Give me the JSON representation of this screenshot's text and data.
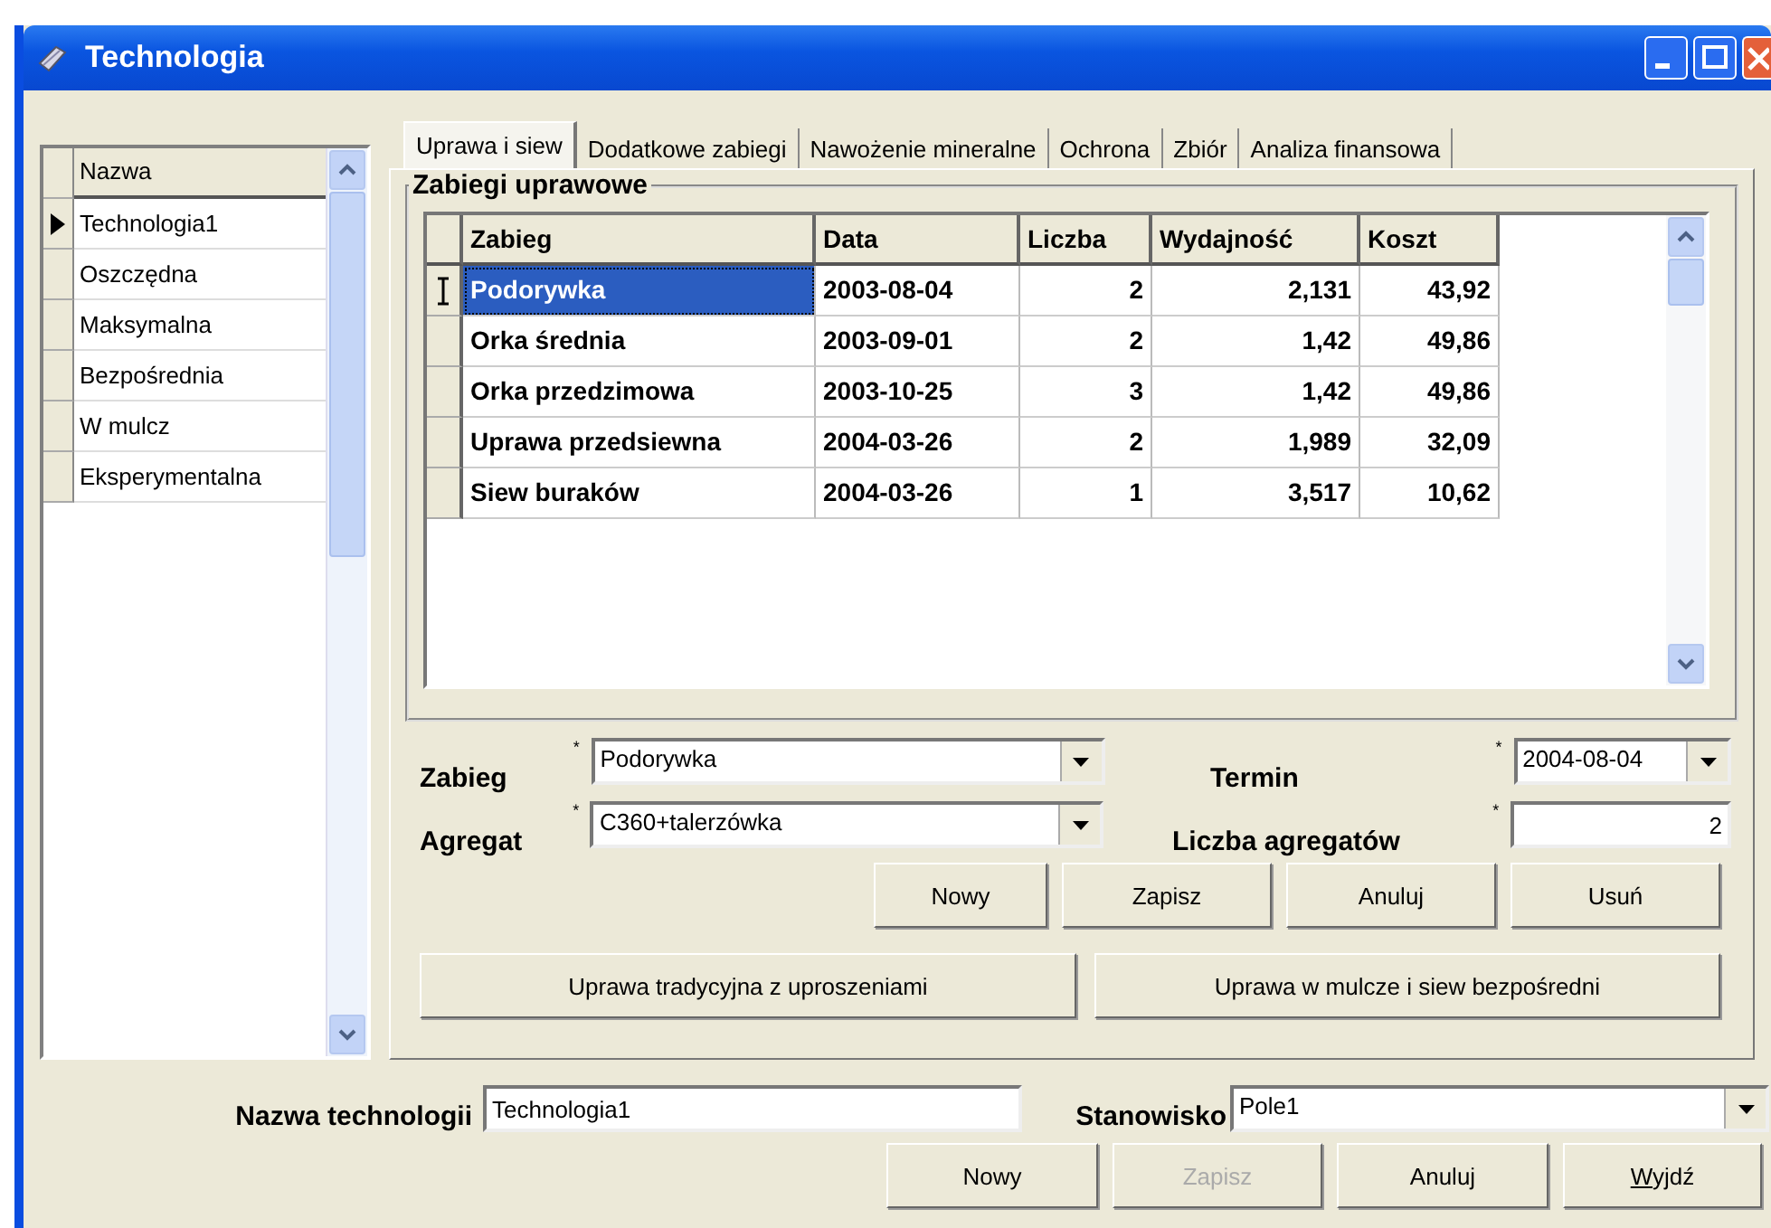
{
  "window": {
    "title": "Technologia"
  },
  "technologies": {
    "column": "Nazwa",
    "rows": [
      {
        "name": "Technologia1",
        "selected": true
      },
      {
        "name": "Oszczędna",
        "selected": false
      },
      {
        "name": "Maksymalna",
        "selected": false
      },
      {
        "name": "Bezpośrednia",
        "selected": false
      },
      {
        "name": "W mulcz",
        "selected": false
      },
      {
        "name": "Eksperymentalna",
        "selected": false
      }
    ]
  },
  "tabs": [
    {
      "label": "Uprawa i siew",
      "selected": true
    },
    {
      "label": "Dodatkowe zabiegi",
      "selected": false
    },
    {
      "label": "Nawożenie mineralne",
      "selected": false
    },
    {
      "label": "Ochrona",
      "selected": false
    },
    {
      "label": "Zbiór",
      "selected": false
    },
    {
      "label": "Analiza finansowa",
      "selected": false
    }
  ],
  "group": {
    "title": "Zabiegi uprawowe",
    "columns": [
      "Zabieg",
      "Data",
      "Liczba",
      "Wydajność",
      "Koszt"
    ],
    "rows": [
      {
        "cells": [
          "Podorywka",
          "2003-08-04",
          "2",
          "2,131",
          "43,92"
        ],
        "selected": true
      },
      {
        "cells": [
          "Orka średnia",
          "2003-09-01",
          "2",
          "1,42",
          "49,86"
        ],
        "selected": false
      },
      {
        "cells": [
          "Orka przedzimowa",
          "2003-10-25",
          "3",
          "1,42",
          "49,86"
        ],
        "selected": false
      },
      {
        "cells": [
          "Uprawa przedsiewna",
          "2004-03-26",
          "2",
          "1,989",
          "32,09"
        ],
        "selected": false
      },
      {
        "cells": [
          "Siew buraków",
          "2004-03-26",
          "1",
          "3,517",
          "10,62"
        ],
        "selected": false
      }
    ]
  },
  "form": {
    "zabieg": {
      "label": "Zabieg",
      "mark": "*",
      "value": "Podorywka"
    },
    "agregat": {
      "label": "Agregat",
      "mark": "*",
      "value": "C360+talerzówka"
    },
    "termin": {
      "label": "Termin",
      "mark": "*",
      "value": "2004-08-04"
    },
    "liczba": {
      "label": "Liczba agregatów",
      "mark": "*",
      "value": "2"
    },
    "buttons": [
      {
        "label": "Nowy",
        "disabled": false
      },
      {
        "label": "Zapisz",
        "disabled": false
      },
      {
        "label": "Anuluj",
        "disabled": false
      },
      {
        "label": "Usuń",
        "disabled": false
      }
    ],
    "presets": [
      "Uprawa tradycyjna z uproszeniami",
      "Uprawa w mulcze i siew bezpośredni"
    ]
  },
  "bottom": {
    "name": {
      "label": "Nazwa technologii",
      "value": "Technologia1"
    },
    "station": {
      "label": "Stanowisko",
      "value": "Pole1"
    },
    "buttons": [
      {
        "label": "Nowy",
        "disabled": false
      },
      {
        "label": "Zapisz",
        "disabled": true
      },
      {
        "label": "Anuluj",
        "disabled": false
      },
      {
        "label": "Wyjdź",
        "disabled": false
      }
    ]
  }
}
